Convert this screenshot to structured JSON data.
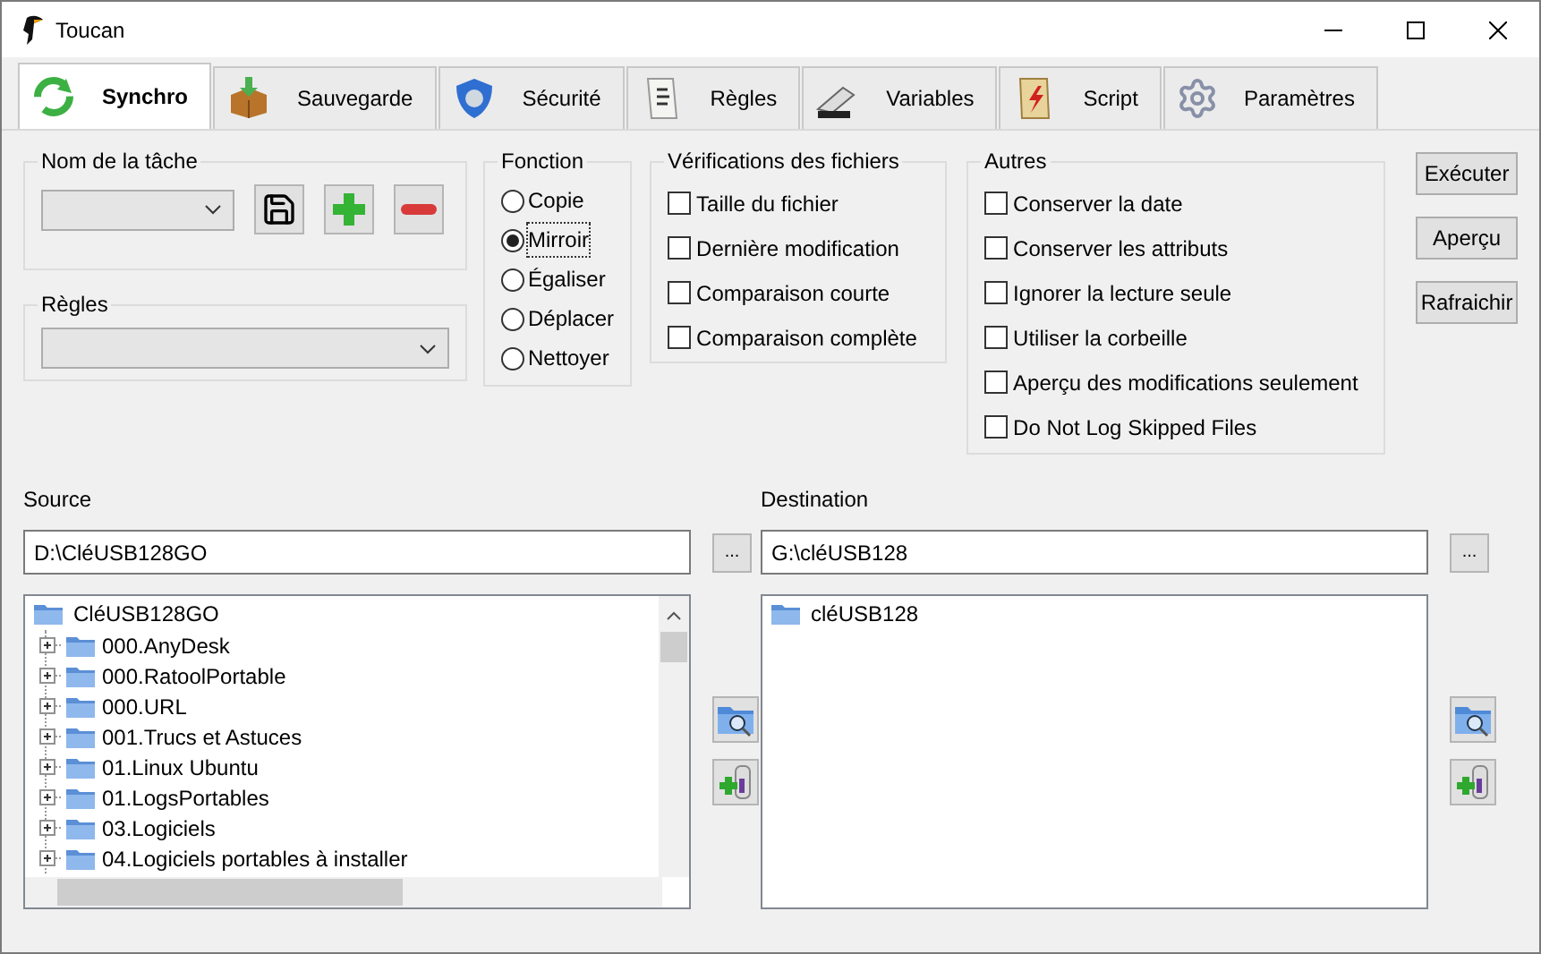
{
  "window": {
    "title": "Toucan"
  },
  "tabs": [
    {
      "label": "Synchro",
      "selected": true,
      "kind": "sync"
    },
    {
      "label": "Sauvegarde",
      "selected": false,
      "kind": "box"
    },
    {
      "label": "Sécurité",
      "selected": false,
      "kind": "shield"
    },
    {
      "label": "Règles",
      "selected": false,
      "kind": "paper"
    },
    {
      "label": "Variables",
      "selected": false,
      "kind": "tag"
    },
    {
      "label": "Script",
      "selected": false,
      "kind": "script"
    },
    {
      "label": "Paramètres",
      "selected": false,
      "kind": "gears"
    }
  ],
  "task_name": {
    "title": "Nom de la tâche"
  },
  "rules": {
    "title": "Règles"
  },
  "function": {
    "title": "Fonction",
    "options": [
      {
        "label": "Copie",
        "selected": false
      },
      {
        "label": "Mirroir",
        "selected": true
      },
      {
        "label": "Égaliser",
        "selected": false
      },
      {
        "label": "Déplacer",
        "selected": false
      },
      {
        "label": "Nettoyer",
        "selected": false
      }
    ]
  },
  "file_checks": {
    "title": "Vérifications des fichiers",
    "items": [
      {
        "label": "Taille du fichier",
        "checked": false
      },
      {
        "label": "Dernière modification",
        "checked": false
      },
      {
        "label": "Comparaison courte",
        "checked": false
      },
      {
        "label": "Comparaison complète",
        "checked": false
      }
    ]
  },
  "others": {
    "title": "Autres",
    "items": [
      {
        "label": "Conserver la date",
        "checked": false
      },
      {
        "label": "Conserver les attributs",
        "checked": false
      },
      {
        "label": "Ignorer la lecture seule",
        "checked": false
      },
      {
        "label": "Utiliser la corbeille",
        "checked": false
      },
      {
        "label": "Aperçu des modifications seulement",
        "checked": false
      },
      {
        "label": "Do Not Log Skipped Files",
        "checked": false
      }
    ]
  },
  "actions": [
    "Exécuter",
    "Aperçu",
    "Rafraichir"
  ],
  "source": {
    "label": "Source",
    "path": "D:\\CléUSB128GO",
    "browse": "...",
    "tree": {
      "label": "CléUSB128GO",
      "children": [
        {
          "label": "000.AnyDesk",
          "expanded": false
        },
        {
          "label": "000.RatoolPortable",
          "expanded": false
        },
        {
          "label": "000.URL",
          "expanded": false
        },
        {
          "label": "001.Trucs et Astuces",
          "expanded": false
        },
        {
          "label": "01.Linux Ubuntu",
          "expanded": false
        },
        {
          "label": "01.LogsPortables",
          "expanded": false
        },
        {
          "label": "03.Logiciels",
          "expanded": false
        },
        {
          "label": "04.Logiciels portables à installer",
          "expanded": false
        }
      ]
    }
  },
  "destination": {
    "label": "Destination",
    "path": "G:\\cléUSB128",
    "browse": "...",
    "tree": {
      "label": "cléUSB128"
    }
  }
}
